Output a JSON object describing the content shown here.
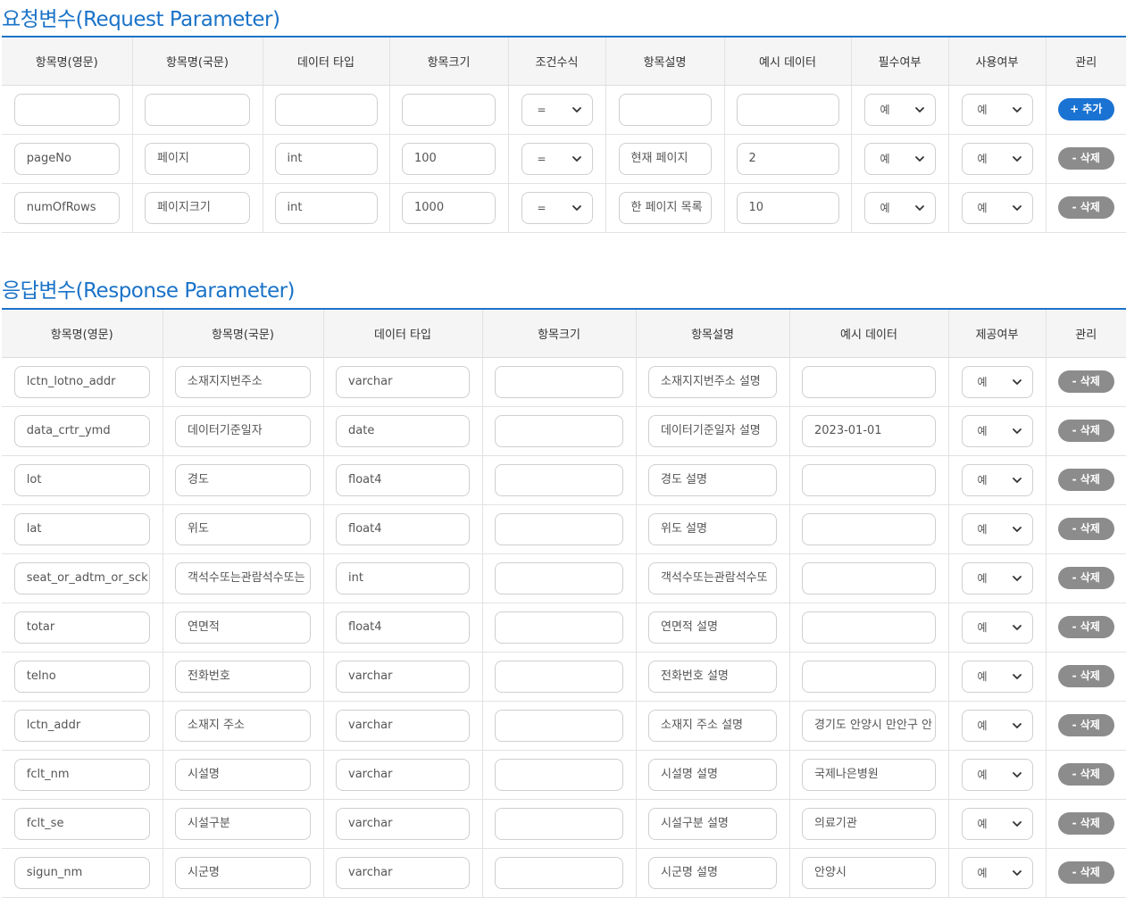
{
  "request": {
    "title": "요청변수(Request Parameter)",
    "headers": [
      "항목명(영문)",
      "항목명(국문)",
      "데이터 타입",
      "항목크기",
      "조건수식",
      "항목설명",
      "예시 데이터",
      "필수여부",
      "사용여부",
      "관리"
    ],
    "rows": [
      {
        "name_en": "",
        "name_ko": "",
        "type": "",
        "size": "",
        "cond": "=",
        "desc": "",
        "example": "",
        "required": "예",
        "used": "예",
        "action": "+ 추가"
      },
      {
        "name_en": "pageNo",
        "name_ko": "페이지",
        "type": "int",
        "size": "100",
        "cond": "=",
        "desc": "현재 페이지",
        "example": "2",
        "required": "예",
        "used": "예",
        "action": "- 삭제"
      },
      {
        "name_en": "numOfRows",
        "name_ko": "페이지크기",
        "type": "int",
        "size": "1000",
        "cond": "=",
        "desc": "한 페이지 목록",
        "example": "10",
        "required": "예",
        "used": "예",
        "action": "- 삭제"
      }
    ]
  },
  "response": {
    "title": "응답변수(Response Parameter)",
    "headers": [
      "항목명(영문)",
      "항목명(국문)",
      "데이터 타입",
      "항목크기",
      "항목설명",
      "예시 데이터",
      "제공여부",
      "관리"
    ],
    "rows": [
      {
        "name_en": "lctn_lotno_addr",
        "name_ko": "소재지지번주소",
        "type": "varchar",
        "size": "",
        "desc": "소재지지번주소 설명",
        "example": "",
        "provided": "예",
        "action": "- 삭제"
      },
      {
        "name_en": "data_crtr_ymd",
        "name_ko": "데이터기준일자",
        "type": "date",
        "size": "",
        "desc": "데이터기준일자 설명",
        "example": "2023-01-01",
        "provided": "예",
        "action": "- 삭제"
      },
      {
        "name_en": "lot",
        "name_ko": "경도",
        "type": "float4",
        "size": "",
        "desc": "경도 설명",
        "example": "",
        "provided": "예",
        "action": "- 삭제"
      },
      {
        "name_en": "lat",
        "name_ko": "위도",
        "type": "float4",
        "size": "",
        "desc": "위도 설명",
        "example": "",
        "provided": "예",
        "action": "- 삭제"
      },
      {
        "name_en": "seat_or_adtm_or_sck",
        "name_ko": "객석수또는관람석수또는",
        "type": "int",
        "size": "",
        "desc": "객석수또는관람석수또",
        "example": "",
        "provided": "예",
        "action": "- 삭제"
      },
      {
        "name_en": "totar",
        "name_ko": "연면적",
        "type": "float4",
        "size": "",
        "desc": "연면적 설명",
        "example": "",
        "provided": "예",
        "action": "- 삭제"
      },
      {
        "name_en": "telno",
        "name_ko": "전화번호",
        "type": "varchar",
        "size": "",
        "desc": "전화번호 설명",
        "example": "",
        "provided": "예",
        "action": "- 삭제"
      },
      {
        "name_en": "lctn_addr",
        "name_ko": "소재지 주소",
        "type": "varchar",
        "size": "",
        "desc": "소재지 주소 설명",
        "example": "경기도 안양시 만안구 안",
        "provided": "예",
        "action": "- 삭제"
      },
      {
        "name_en": "fclt_nm",
        "name_ko": "시설명",
        "type": "varchar",
        "size": "",
        "desc": "시설명 설명",
        "example": "국제나은병원",
        "provided": "예",
        "action": "- 삭제"
      },
      {
        "name_en": "fclt_se",
        "name_ko": "시설구분",
        "type": "varchar",
        "size": "",
        "desc": "시설구분 설명",
        "example": "의료기관",
        "provided": "예",
        "action": "- 삭제"
      },
      {
        "name_en": "sigun_nm",
        "name_ko": "시군명",
        "type": "varchar",
        "size": "",
        "desc": "시군명 설명",
        "example": "안양시",
        "provided": "예",
        "action": "- 삭제"
      }
    ]
  }
}
